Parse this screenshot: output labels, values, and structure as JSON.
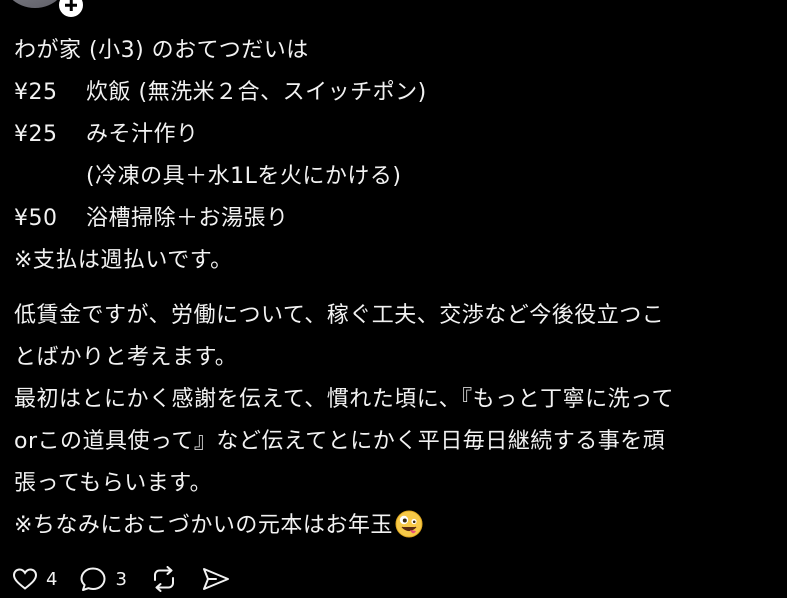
{
  "post": {
    "intro": "わが家 (小3) のおてつだいは",
    "chores": [
      {
        "price": "¥25",
        "task": "炊飯 (無洗米２合、スイッチポン)"
      },
      {
        "price": "¥25",
        "task": "みそ汁作り"
      },
      {
        "price": "",
        "task": "(冷凍の具＋水1Lを火にかける)"
      },
      {
        "price": "¥50",
        "task": "浴槽掃除＋お湯張り"
      }
    ],
    "payment_note": "※支払は週払いです。",
    "paragraph_1": [
      "低賃金ですが、労働について、稼ぐ工夫、交渉など今後役立つこ",
      "とばかりと考えます。"
    ],
    "paragraph_2": [
      "最初はとにかく感謝を伝えて、慣れた頃に、『もっと丁寧に洗って",
      "orこの道具使って』など伝えてとにかく平日毎日継続する事を頑",
      "張ってもらいます。"
    ],
    "closing": "※ちなみにおこづかいの元本はお年玉",
    "emoji": "zany-face"
  },
  "actions": {
    "likes": "4",
    "replies": "3"
  },
  "colors": {
    "background": "#000000",
    "text": "#f2f2f2",
    "avatar": "#8a8a92"
  }
}
